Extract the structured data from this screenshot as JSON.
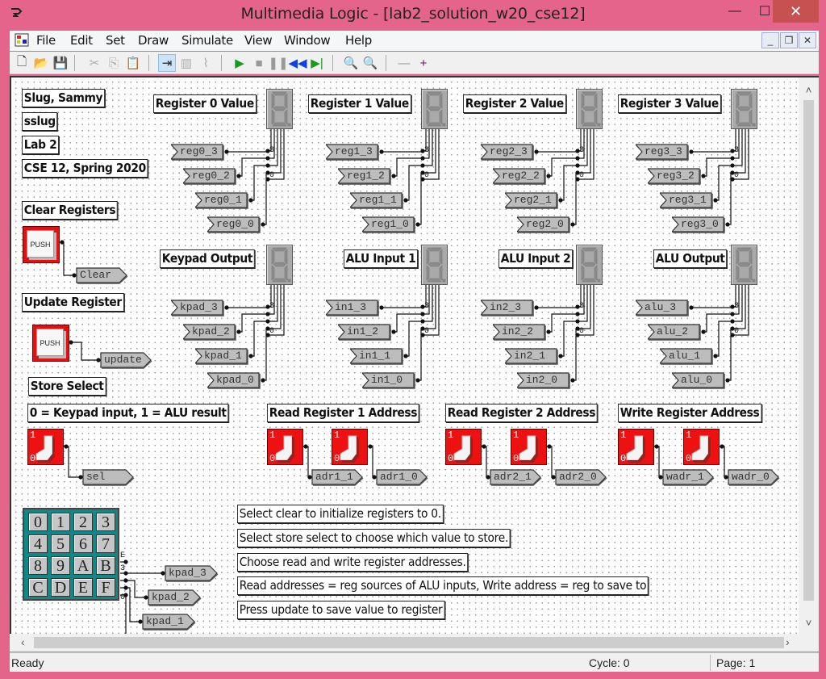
{
  "window": {
    "title": "Multimedia Logic - [lab2_solution_w20_cse12]",
    "minimize": "—",
    "maximize": "☐",
    "close": "✕"
  },
  "menu": {
    "items": [
      "File",
      "Edit",
      "Set",
      "Draw",
      "Simulate",
      "View",
      "Window",
      "Help"
    ],
    "mdi_minimize": "_",
    "mdi_restore": "❐",
    "mdi_close": "✕"
  },
  "toolbar": {
    "tools": [
      {
        "name": "new-icon",
        "glyph": "🗋",
        "color": "#222"
      },
      {
        "name": "open-icon",
        "glyph": "📂",
        "color": "#c8a000"
      },
      {
        "name": "save-icon",
        "glyph": "💾",
        "color": "#222"
      },
      {
        "name": "cut-icon",
        "glyph": "✂",
        "color": "#aaa"
      },
      {
        "name": "copy-icon",
        "glyph": "⎘",
        "color": "#aaa"
      },
      {
        "name": "paste-icon",
        "glyph": "📋",
        "color": "#aaa"
      },
      {
        "name": "select-mode-icon",
        "glyph": "⇥",
        "color": "#222"
      },
      {
        "name": "device-icon",
        "glyph": "▥",
        "color": "#aaa"
      },
      {
        "name": "wire-icon",
        "glyph": "⌇",
        "color": "#aaa"
      },
      {
        "name": "run-icon",
        "glyph": "▶",
        "color": "#1a9a1a"
      },
      {
        "name": "stop-icon",
        "glyph": "■",
        "color": "#999"
      },
      {
        "name": "pause-icon",
        "glyph": "❚❚",
        "color": "#999"
      },
      {
        "name": "rewind-icon",
        "glyph": "◀◀",
        "color": "#1040e0"
      },
      {
        "name": "step-icon",
        "glyph": "▶|",
        "color": "#1a9a1a"
      },
      {
        "name": "zoom-out-icon",
        "glyph": "🔍",
        "color": "#333"
      },
      {
        "name": "zoom-in-icon",
        "glyph": "🔍",
        "color": "#1040e0"
      },
      {
        "name": "page-remove-icon",
        "glyph": "—",
        "color": "#999"
      },
      {
        "name": "page-add-icon",
        "glyph": "+",
        "color": "#880088"
      }
    ]
  },
  "canvas": {
    "info_labels": [
      "Slug, Sammy",
      "sslug",
      "Lab 2",
      "CSE 12, Spring 2020"
    ],
    "clear_label": "Clear Registers",
    "update_label": "Update Register",
    "store_select_label": "Store Select",
    "store_select_desc": "0 = Keypad input, 1 = ALU result",
    "push_text": "PUSH",
    "clear_tag": "Clear",
    "update_tag": "update",
    "sel_tag": "sel",
    "switch_one": "1",
    "switch_zero": "0",
    "displays": [
      {
        "label": "Register 0 Value",
        "tags": [
          "reg0_3",
          "reg0_2",
          "reg0_1",
          "reg0_0"
        ]
      },
      {
        "label": "Register 1 Value",
        "tags": [
          "reg1_3",
          "reg1_2",
          "reg1_1",
          "reg1_0"
        ]
      },
      {
        "label": "Register 2 Value",
        "tags": [
          "reg2_3",
          "reg2_2",
          "reg2_1",
          "reg2_0"
        ]
      },
      {
        "label": "Register 3 Value",
        "tags": [
          "reg3_3",
          "reg3_2",
          "reg3_1",
          "reg3_0"
        ]
      },
      {
        "label": "Keypad Output",
        "tags": [
          "kpad_3",
          "kpad_2",
          "kpad_1",
          "kpad_0"
        ]
      },
      {
        "label": "ALU Input 1",
        "tags": [
          "in1_3",
          "in1_2",
          "in1_1",
          "in1_0"
        ]
      },
      {
        "label": "ALU Input 2",
        "tags": [
          "in2_3",
          "in2_2",
          "in2_1",
          "in2_0"
        ]
      },
      {
        "label": "ALU Output",
        "tags": [
          "alu_3",
          "alu_2",
          "alu_1",
          "alu_0"
        ]
      }
    ],
    "bit_high": "3",
    "bit_low": "0",
    "address_groups": [
      {
        "label": "Read Register 1 Address",
        "tags": [
          "adr1_1",
          "adr1_0"
        ]
      },
      {
        "label": "Read Register 2 Address",
        "tags": [
          "adr2_1",
          "adr2_0"
        ]
      },
      {
        "label": "Write Register Address",
        "tags": [
          "wadr_1",
          "wadr_0"
        ]
      }
    ],
    "keypad": {
      "keys": [
        "0",
        "1",
        "2",
        "3",
        "4",
        "5",
        "6",
        "7",
        "8",
        "9",
        "A",
        "B",
        "C",
        "D",
        "E",
        "F"
      ],
      "pin_e": "E",
      "pin_3": "3",
      "pin_0": "0",
      "tags": [
        "kpad_3",
        "kpad_2",
        "kpad_1"
      ]
    },
    "instructions": [
      "Select clear to initialize registers to 0.",
      "Select store select to choose which value to store.",
      "Choose read and write register addresses.",
      "Read addresses = reg sources of ALU inputs, Write address = reg to save to",
      "Press update to save value to register"
    ]
  },
  "scroll": {
    "up": "˄",
    "down": "˅",
    "left": "‹",
    "right": "›"
  },
  "status": {
    "text": "Ready",
    "cycle": "Cycle: 0",
    "page": "Page: 1"
  },
  "colors": {
    "titlebar": "#e4648c",
    "close": "#c75050",
    "switch_red": "#ee1111",
    "keypad_teal": "#108888"
  }
}
